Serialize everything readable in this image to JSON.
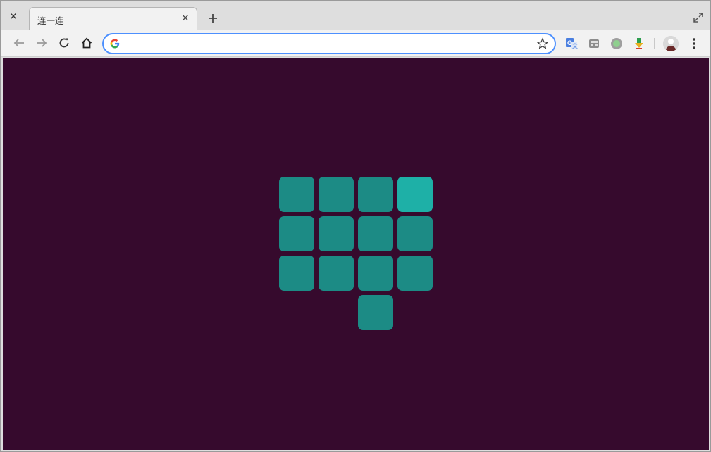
{
  "browser": {
    "tab": {
      "title": "连一连"
    },
    "omnibox": {
      "value": "",
      "placeholder": ""
    }
  },
  "icons": {
    "window_close": "close-icon",
    "tab_close": "close-icon",
    "new_tab": "plus-icon",
    "maximize": "maximize-icon",
    "back": "arrow-left-icon",
    "forward": "arrow-right-icon",
    "reload": "reload-icon",
    "home": "home-icon",
    "search_engine": "google-g-icon",
    "bookmark": "star-icon",
    "extensions": [
      "translate-icon",
      "extension-icon",
      "extension-circle-icon",
      "download-extension-icon"
    ],
    "profile": "avatar",
    "menu": "more-vertical-icon"
  },
  "game": {
    "background_color": "#360a2d",
    "tile_color": "#1c8b85",
    "active_tile_color": "#1eb0a7",
    "board": [
      [
        1,
        1,
        1,
        2
      ],
      [
        1,
        1,
        1,
        1
      ],
      [
        1,
        1,
        1,
        1
      ],
      [
        0,
        0,
        1,
        0
      ]
    ],
    "legend": {
      "0": "empty",
      "1": "tile",
      "2": "active tile"
    }
  }
}
